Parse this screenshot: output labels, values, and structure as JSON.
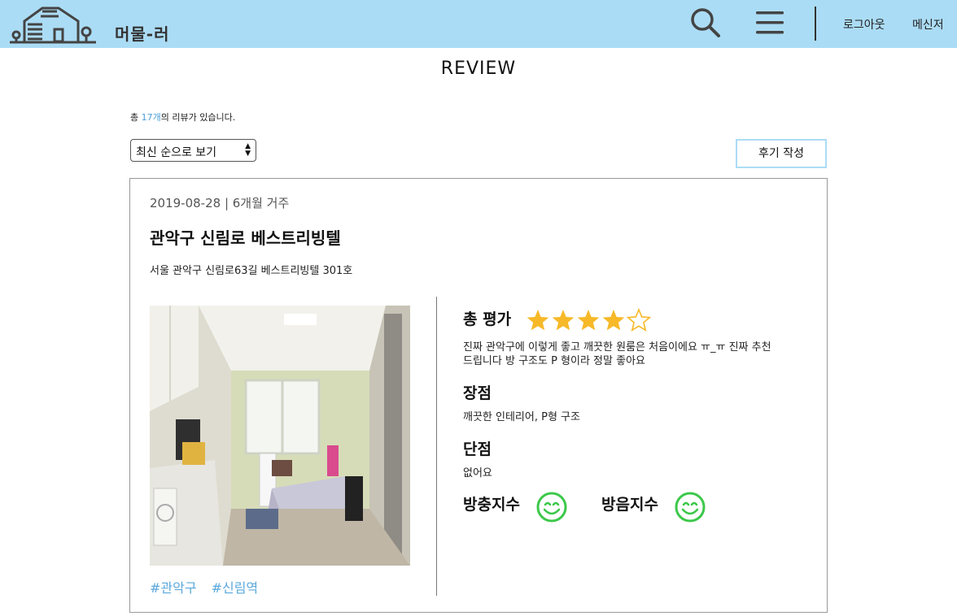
{
  "header": {
    "brand": "머물-러",
    "logout_label": "로그아웃",
    "messenger_label": "메신저",
    "icons": [
      "house-logo-icon",
      "search-icon",
      "hamburger-menu-icon"
    ]
  },
  "page": {
    "title": "REVIEW",
    "count_prefix": "총 ",
    "count_value": "17개",
    "count_suffix": "의 리뷰가 있습니다.",
    "sort_selected": "최신 순으로 보기",
    "write_button": "후기 작성"
  },
  "review": {
    "date_stay": "2019-08-28 | 6개월 거주",
    "building": "관악구 신림로 베스트리빙텔",
    "address": "서울 관악구 신림로63길 베스트리빙텔 301호",
    "tags": [
      "#관악구",
      "#신림역"
    ],
    "overall_label": "총 평가",
    "rating": 4,
    "rating_max": 5,
    "overall_text_1": "진짜 관악구에 이렇게 좋고 깨끗한 원룸은 처음이에요 ㅠ_ㅠ 진짜 추천",
    "overall_text_2": "드립니다 방 구조도 P 형이라 정말 좋아요",
    "pros_label": "장점",
    "pros_text": "깨끗한 인테리어, P형 구조",
    "cons_label": "단점",
    "cons_text": "없어요",
    "insulation_label": "방충지수",
    "noise_label": "방음지수",
    "insulation_face": "smile-face-icon",
    "noise_face": "smile-face-icon"
  },
  "colors": {
    "header_bg": "#abdcf5",
    "star": "#f7b928",
    "accent_link": "#5aa8dc",
    "face": "#3cc84a"
  }
}
